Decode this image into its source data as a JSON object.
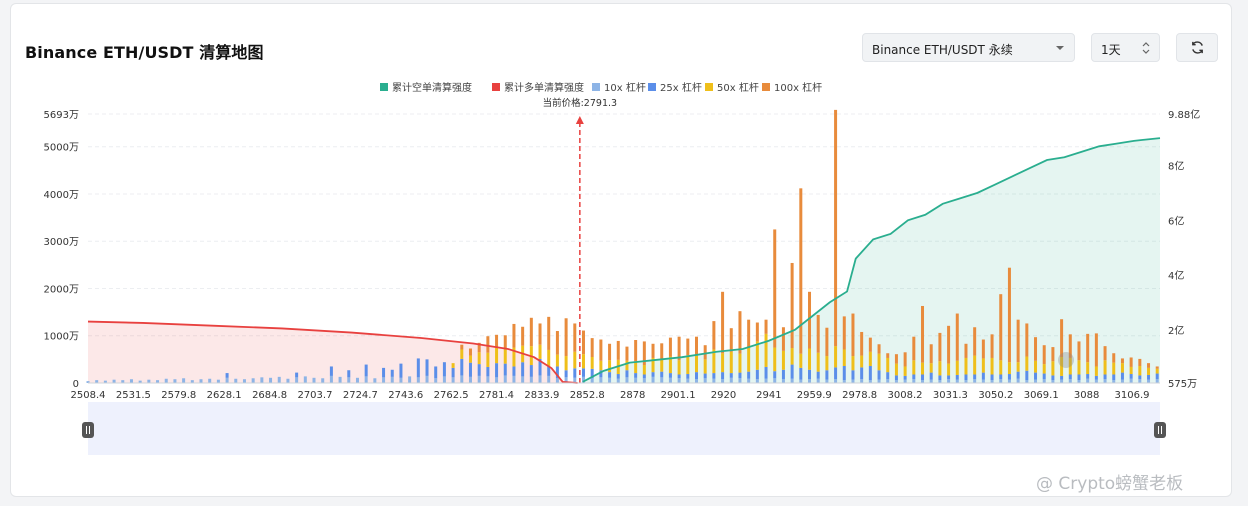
{
  "header": {
    "title": "Binance ETH/USDT 清算地图",
    "pair_select": "Binance ETH/USDT 永续",
    "interval_select": "1天",
    "refresh_icon": "refresh-icon",
    "select_caret_icon": "chevron-down-icon",
    "spinner_icon": "up-down-spinner-icon"
  },
  "colors": {
    "short_cum": "#2aae8f",
    "long_cum": "#e8413f",
    "lev10": "#8db4e6",
    "lev25": "#5b8ee9",
    "lev50": "#efbf1a",
    "lev100": "#e88b3c",
    "price_line": "#e8413f"
  },
  "watermark": "@ Crypto螃蟹老板",
  "chart_data": {
    "type": "bar",
    "legend": [
      {
        "label": "累计空单清算强度",
        "color": "#2aae8f"
      },
      {
        "label": "累计多单清算强度",
        "color": "#e8413f"
      },
      {
        "label": "10x 杠杆",
        "color": "#8db4e6"
      },
      {
        "label": "25x 杠杆",
        "color": "#5b8ee9"
      },
      {
        "label": "50x 杠杆",
        "color": "#efbf1a"
      },
      {
        "label": "100x 杠杆",
        "color": "#e88b3c"
      }
    ],
    "legend_position": "top",
    "current_price": 2791.3,
    "current_price_label": "当前价格:2791.3",
    "xlim": [
      2508.4,
      3125
    ],
    "x_ticks": [
      "2508.4",
      "2531.5",
      "2579.8",
      "2628.1",
      "2684.8",
      "2703.7",
      "2724.7",
      "2743.6",
      "2762.5",
      "2781.4",
      "2833.9",
      "2852.8",
      "2878",
      "2901.1",
      "2920",
      "2941",
      "2959.9",
      "2978.8",
      "3008.2",
      "3031.3",
      "3050.2",
      "3069.1",
      "3088",
      "3106.9"
    ],
    "y_left": {
      "ticks": [
        "0",
        "1000万",
        "2000万",
        "3000万",
        "4000万",
        "5000万",
        "5693万"
      ],
      "values": [
        0,
        1000,
        2000,
        3000,
        4000,
        5000,
        5693
      ],
      "unit": "万"
    },
    "y_right": {
      "ticks": [
        "575万",
        "2亿",
        "4亿",
        "6亿",
        "8亿",
        "9.88亿"
      ],
      "values": [
        0.0575,
        2,
        4,
        6,
        8,
        9.88
      ],
      "unit": "亿"
    },
    "grid": "dashed-horizontal",
    "bar_series": {
      "unit": "万",
      "positions": [
        2508.4,
        2513.4,
        2518.4,
        2523.4,
        2528.4,
        2533.4,
        2538.4,
        2543.4,
        2548.4,
        2553.4,
        2558.4,
        2563.4,
        2568.4,
        2573.4,
        2578.4,
        2583.4,
        2588.4,
        2593.4,
        2598.4,
        2603.4,
        2608.4,
        2613.4,
        2618.4,
        2623.4,
        2628.4,
        2633.4,
        2638.4,
        2643.4,
        2648.4,
        2653.4,
        2658.4,
        2663.4,
        2668.4,
        2673.4,
        2678.4,
        2683.4,
        2688.4,
        2693.4,
        2698.4,
        2703.4,
        2708.4,
        2713.4,
        2718.4,
        2723.4,
        2728.4,
        2733.4,
        2738.4,
        2743.4,
        2748.4,
        2753.4,
        2758.4,
        2763.4,
        2768.4,
        2773.4,
        2778.4,
        2783.4,
        2788.4,
        2793.4,
        2798.4,
        2803.4,
        2808.4,
        2813.4,
        2818.4,
        2823.4,
        2828.4,
        2833.4,
        2838.4,
        2843.4,
        2848.4,
        2853.4,
        2858.4,
        2863.4,
        2868.4,
        2873.4,
        2878.4,
        2883.4,
        2888.4,
        2893.4,
        2898.4,
        2903.4,
        2908.4,
        2913.4,
        2918.4,
        2923.4,
        2928.4,
        2933.4,
        2938.4,
        2943.4,
        2948.4,
        2953.4,
        2958.4,
        2963.4,
        2968.4,
        2973.4,
        2978.4,
        2983.4,
        2988.4,
        2993.4,
        2998.4,
        3003.4,
        3008.4,
        3013.4,
        3018.4,
        3023.4,
        3028.4,
        3033.4,
        3038.4,
        3043.4,
        3048.4,
        3053.4,
        3058.4,
        3063.4,
        3068.4,
        3073.4,
        3078.4,
        3083.4,
        3088.4,
        3093.4,
        3098.4,
        3103.4,
        3108.4,
        3113.4,
        3118.4,
        3123.4
      ],
      "lev10": [
        40,
        60,
        50,
        70,
        60,
        80,
        50,
        70,
        60,
        90,
        80,
        100,
        60,
        80,
        90,
        70,
        110,
        90,
        80,
        100,
        120,
        110,
        130,
        90,
        120,
        140,
        110,
        100,
        150,
        130,
        120,
        110,
        140,
        100,
        120,
        130,
        110,
        140,
        120,
        150,
        100,
        140,
        120,
        160,
        130,
        150,
        140,
        120,
        160,
        150,
        140,
        130,
        160,
        150,
        100,
        120,
        110,
        130,
        100,
        120,
        110,
        90,
        120,
        110,
        100,
        130,
        120,
        110,
        100,
        90,
        80,
        100,
        90,
        80,
        110,
        100,
        90,
        80,
        90,
        100,
        80,
        90,
        70,
        80,
        90,
        70,
        80,
        60,
        70,
        80,
        60,
        70,
        80,
        60,
        70,
        80,
        60,
        70,
        60,
        80,
        70,
        60,
        80,
        70,
        60,
        80,
        70,
        90,
        60,
        70,
        80,
        60,
        70,
        80,
        60,
        90,
        70,
        80,
        60,
        70,
        90,
        80,
        70,
        80
      ],
      "lev25": [
        0,
        0,
        0,
        0,
        0,
        0,
        0,
        0,
        0,
        0,
        0,
        0,
        0,
        0,
        0,
        0,
        100,
        0,
        0,
        0,
        0,
        0,
        0,
        0,
        100,
        0,
        0,
        0,
        200,
        0,
        150,
        0,
        250,
        0,
        200,
        150,
        300,
        0,
        400,
        350,
        250,
        300,
        200,
        350,
        300,
        250,
        200,
        300,
        250,
        200,
        300,
        250,
        350,
        200,
        250,
        150,
        200,
        180,
        200,
        150,
        120,
        100,
        150,
        100,
        80,
        100,
        120,
        100,
        80,
        100,
        150,
        100,
        120,
        150,
        100,
        120,
        150,
        200,
        250,
        150,
        200,
        300,
        250,
        200,
        150,
        200,
        250,
        300,
        200,
        250,
        300,
        200,
        150,
        100,
        80,
        100,
        120,
        150,
        100,
        80,
        100,
        120,
        100,
        150,
        120,
        100,
        120,
        150,
        200,
        150,
        120,
        100,
        80,
        100,
        120,
        100,
        80,
        100,
        120,
        150,
        100,
        80,
        100,
        120
      ],
      "lev50": [
        0,
        0,
        0,
        0,
        0,
        0,
        0,
        0,
        0,
        0,
        0,
        0,
        0,
        0,
        0,
        0,
        0,
        0,
        0,
        0,
        0,
        0,
        0,
        0,
        0,
        0,
        0,
        0,
        0,
        0,
        0,
        0,
        0,
        0,
        0,
        0,
        0,
        0,
        0,
        0,
        0,
        0,
        100,
        200,
        150,
        250,
        300,
        350,
        300,
        400,
        350,
        400,
        300,
        350,
        250,
        300,
        350,
        300,
        250,
        200,
        250,
        300,
        200,
        250,
        200,
        300,
        250,
        350,
        300,
        400,
        350,
        300,
        500,
        400,
        450,
        400,
        500,
        600,
        700,
        500,
        400,
        350,
        300,
        450,
        400,
        300,
        450,
        350,
        300,
        250,
        300,
        350,
        300,
        250,
        200,
        300,
        250,
        200,
        300,
        250,
        300,
        350,
        400,
        300,
        350,
        300,
        250,
        200,
        300,
        250,
        200,
        300,
        400,
        350,
        300,
        250,
        200,
        300,
        250,
        200,
        150,
        200,
        150,
        100
      ],
      "lev100": [
        0,
        0,
        0,
        0,
        0,
        0,
        0,
        0,
        0,
        0,
        0,
        0,
        0,
        0,
        0,
        0,
        0,
        0,
        0,
        0,
        0,
        0,
        0,
        0,
        0,
        0,
        0,
        0,
        0,
        0,
        0,
        0,
        0,
        0,
        0,
        0,
        0,
        0,
        0,
        0,
        0,
        0,
        0,
        100,
        150,
        200,
        350,
        250,
        300,
        500,
        400,
        600,
        450,
        700,
        500,
        800,
        600,
        500,
        400,
        450,
        350,
        400,
        300,
        450,
        500,
        300,
        350,
        400,
        500,
        350,
        400,
        300,
        600,
        1300,
        500,
        900,
        600,
        400,
        300,
        2500,
        500,
        1800,
        3500,
        1200,
        800,
        600,
        5000,
        700,
        900,
        500,
        300,
        200,
        100,
        200,
        300,
        500,
        1200,
        400,
        600,
        800,
        1000,
        300,
        600,
        400,
        500,
        1400,
        2000,
        900,
        700,
        500,
        400,
        300,
        800,
        500,
        400,
        600,
        700,
        300,
        200,
        100,
        200,
        150,
        100,
        50
      ]
    },
    "long_cumulative": {
      "unit": "亿",
      "x": [
        2508.4,
        2540,
        2580,
        2620,
        2660,
        2700,
        2730,
        2750,
        2765,
        2775,
        2781.4,
        2790
      ],
      "y": [
        2.3,
        2.25,
        2.15,
        2.05,
        1.9,
        1.7,
        1.5,
        1.3,
        1.0,
        0.6,
        0.1,
        0.0575
      ]
    },
    "short_cumulative": {
      "unit": "亿",
      "x": [
        2793,
        2805,
        2820,
        2835,
        2850,
        2870,
        2885,
        2900,
        2915,
        2925,
        2935,
        2945,
        2950,
        2960,
        2970,
        2980,
        2990,
        3000,
        3010,
        3020,
        3030,
        3040,
        3050,
        3060,
        3070,
        3080,
        3090,
        3100,
        3110,
        3125
      ],
      "y": [
        0.1,
        0.5,
        0.8,
        0.9,
        1.0,
        1.2,
        1.3,
        1.6,
        2.0,
        2.5,
        3.0,
        3.4,
        4.6,
        5.3,
        5.5,
        6.0,
        6.2,
        6.6,
        6.8,
        7.0,
        7.3,
        7.6,
        7.9,
        8.2,
        8.3,
        8.5,
        8.7,
        8.8,
        8.9,
        9.0
      ]
    }
  }
}
